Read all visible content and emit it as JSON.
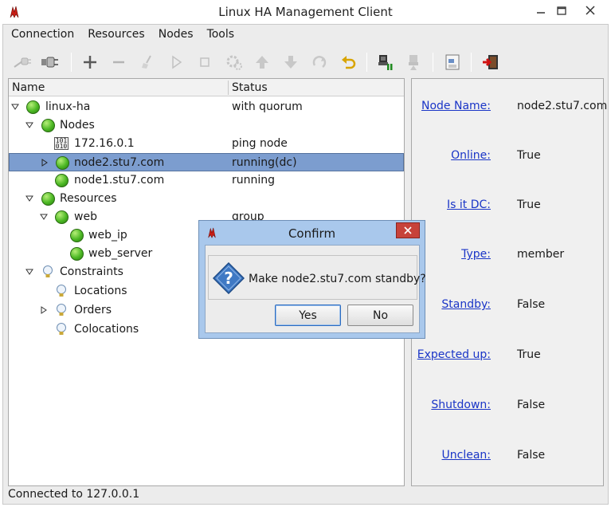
{
  "window": {
    "title": "Linux HA Management Client"
  },
  "menubar": [
    "Connection",
    "Resources",
    "Nodes",
    "Tools"
  ],
  "toolbar": {
    "icons": [
      "login-icon",
      "logout-icon",
      "add-icon",
      "remove-icon",
      "cleanup-icon",
      "start-icon",
      "stop-icon",
      "default-icon",
      "move-up-icon",
      "move-down-icon",
      "refresh-icon",
      "undo-icon",
      "standby-icon",
      "active-icon",
      "view-xml-icon",
      "exit-icon"
    ]
  },
  "tree": {
    "columns": {
      "name": "Name",
      "status": "Status"
    },
    "rows": [
      {
        "label": "linux-ha",
        "status": "with quorum",
        "icon": "green-status-icon"
      },
      {
        "label": "Nodes",
        "status": "",
        "icon": "green-status-icon"
      },
      {
        "label": "172.16.0.1",
        "status": "ping node",
        "icon": "ip-address-icon"
      },
      {
        "label": "node2.stu7.com",
        "status": "running(dc)",
        "icon": "green-status-icon"
      },
      {
        "label": "node1.stu7.com",
        "status": "running",
        "icon": "green-status-icon"
      },
      {
        "label": "Resources",
        "status": "",
        "icon": "green-status-icon"
      },
      {
        "label": "web",
        "status": "group",
        "icon": "green-status-icon"
      },
      {
        "label": "web_ip",
        "status": "",
        "icon": "green-status-icon"
      },
      {
        "label": "web_server",
        "status": "",
        "icon": "green-status-icon"
      },
      {
        "label": "Constraints",
        "status": "",
        "icon": "lightbulb-icon"
      },
      {
        "label": "Locations",
        "status": "",
        "icon": "lightbulb-icon"
      },
      {
        "label": "Orders",
        "status": "",
        "icon": "lightbulb-icon"
      },
      {
        "label": "Colocations",
        "status": "",
        "icon": "lightbulb-icon"
      }
    ]
  },
  "properties": [
    {
      "key": "Node Name:",
      "value": "node2.stu7.com"
    },
    {
      "key": "Online:",
      "value": "True"
    },
    {
      "key": "Is it DC:",
      "value": "True"
    },
    {
      "key": "Type:",
      "value": "member"
    },
    {
      "key": "Standby:",
      "value": "False"
    },
    {
      "key": "Expected up:",
      "value": "True"
    },
    {
      "key": "Shutdown:",
      "value": "False"
    },
    {
      "key": "Unclean:",
      "value": "False"
    }
  ],
  "statusbar": {
    "text": "Connected to 127.0.0.1"
  },
  "dialog": {
    "title": "Confirm",
    "message": "Make node2.stu7.com standby?",
    "yes_label": "Yes",
    "no_label": "No"
  },
  "colors": {
    "selection": "#7c9dcf",
    "link": "#1a35c7",
    "dialog_frame": "#a9c8ec",
    "close_red": "#c7423a"
  }
}
